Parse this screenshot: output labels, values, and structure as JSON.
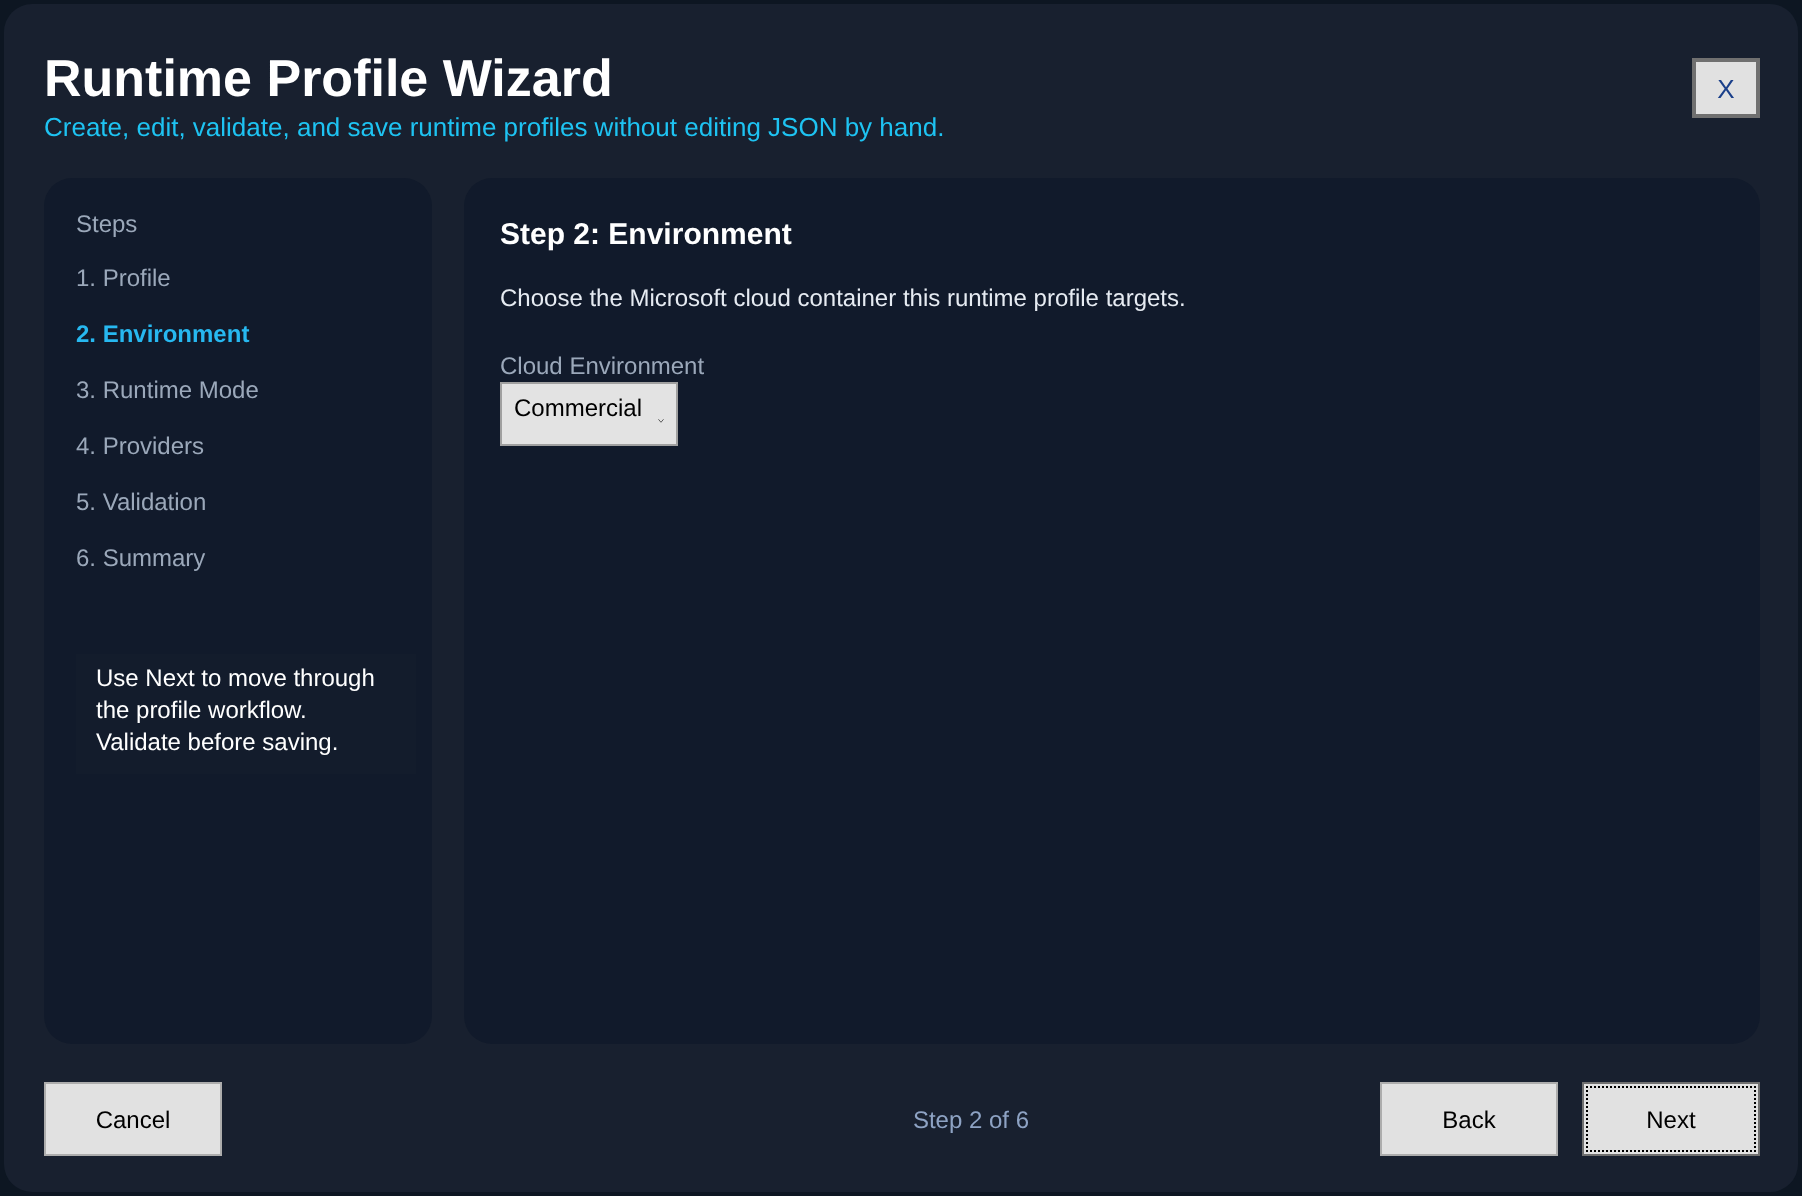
{
  "window": {
    "title": "Runtime Profile Wizard",
    "subtitle": "Create, edit, validate, and save runtime profiles without editing JSON by hand.",
    "close_label": "X"
  },
  "sidebar": {
    "heading": "Steps",
    "items": [
      {
        "label": "1. Profile",
        "selected": false
      },
      {
        "label": "2. Environment",
        "selected": true
      },
      {
        "label": "3. Runtime Mode",
        "selected": false
      },
      {
        "label": "4. Providers",
        "selected": false
      },
      {
        "label": "5. Validation",
        "selected": false
      },
      {
        "label": "6. Summary",
        "selected": false
      }
    ],
    "note": "Use Next to move through the profile workflow. Validate before saving."
  },
  "content": {
    "heading": "Step 2: Environment",
    "description": "Choose the Microsoft cloud container this runtime profile targets.",
    "field": {
      "label": "Cloud Environment",
      "value": "Commercial"
    }
  },
  "footer": {
    "cancel": "Cancel",
    "progress": "Step 2 of 6",
    "back": "Back",
    "next": "Next",
    "next_focused": true
  }
}
